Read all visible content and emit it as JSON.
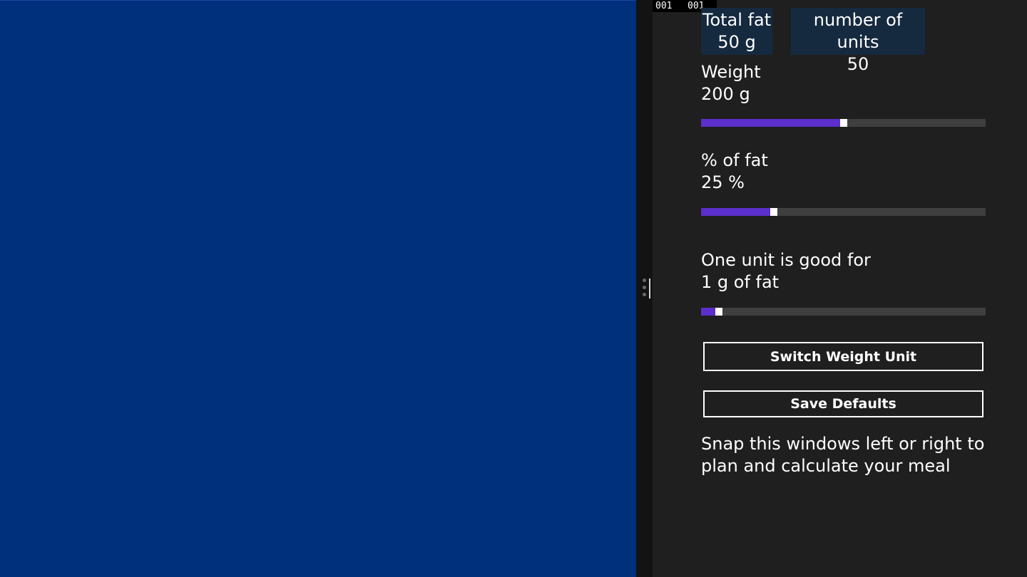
{
  "debug_counters": [
    "001",
    "001"
  ],
  "summary": {
    "total_fat_label": "Total fat",
    "total_fat_value": "50 g",
    "units_label": "number of units",
    "units_value": "50"
  },
  "weight": {
    "label": "Weight",
    "value": "200 g",
    "slider_fraction": 0.5
  },
  "fat_percent": {
    "label": "% of fat",
    "value": "25 %",
    "slider_fraction": 0.256
  },
  "unit_ratio": {
    "label": "One unit is good for",
    "value": "1 g of fat",
    "slider_fraction": 0.063
  },
  "buttons": {
    "switch_unit": "Switch Weight Unit",
    "save_defaults": "Save Defaults"
  },
  "hint_text": "Snap this windows left or right to plan and calculate your meal",
  "colors": {
    "left_pane": "#002f7c",
    "app_bg": "#1f1f1f",
    "tile_bg": "#15293f",
    "slider_fill": "#5b2fcc",
    "slider_track": "#3f3f3f"
  }
}
